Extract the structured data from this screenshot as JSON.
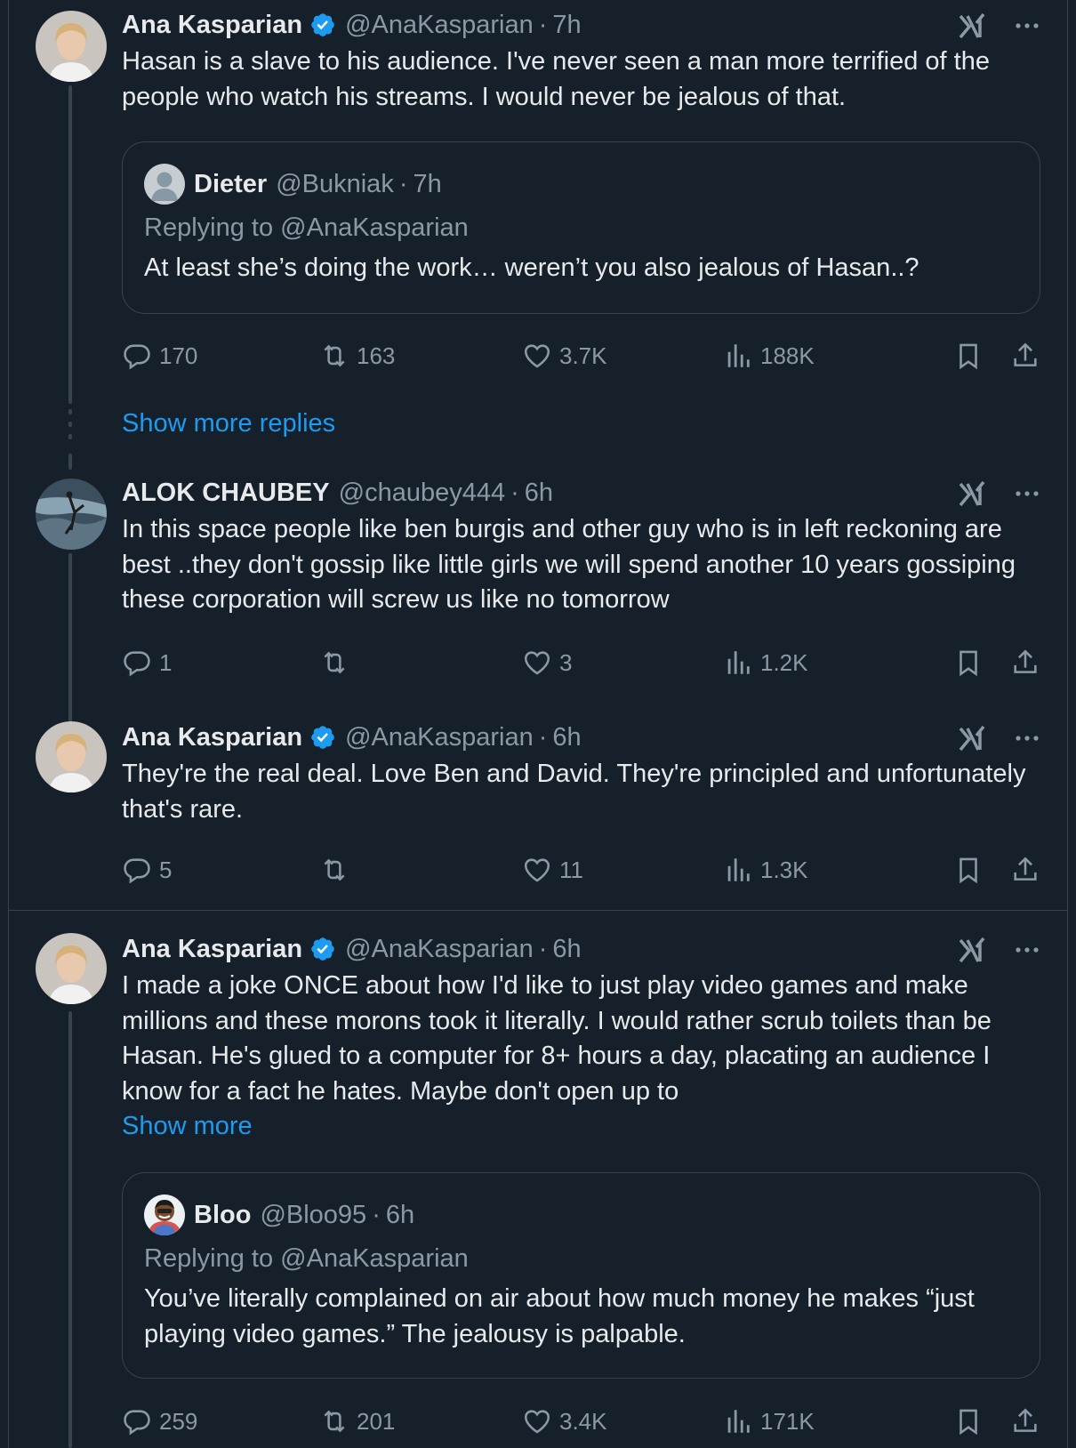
{
  "tweets": [
    {
      "name": "Ana Kasparian",
      "handle": "@AnaKasparian",
      "time": "7h",
      "verified": true,
      "text": "Hasan is a slave to his audience. I've never seen a man more terrified of the people who watch his streams. I would never be jealous of that.",
      "quote": {
        "name": "Dieter",
        "handle": "@Bukniak",
        "time": "7h",
        "replying_prefix": "Replying to ",
        "replying_handle": "@AnaKasparian",
        "text": "At least she’s doing the work… weren’t you also jealous of Hasan..?"
      },
      "stats": {
        "replies": "170",
        "retweets": "163",
        "likes": "3.7K",
        "views": "188K"
      }
    },
    {
      "show_more_replies": "Show more replies"
    },
    {
      "name": "ALOK CHAUBEY",
      "handle": "@chaubey444",
      "time": "6h",
      "verified": false,
      "text": "In this space people like ben burgis and other guy who is in left reckoning are best ..they don't gossip like little girls we will spend another 10 years gossiping these corporation will screw us like no tomorrow",
      "stats": {
        "replies": "1",
        "retweets": "",
        "likes": "3",
        "views": "1.2K"
      }
    },
    {
      "name": "Ana Kasparian",
      "handle": "@AnaKasparian",
      "time": "6h",
      "verified": true,
      "text": "They're the real deal. Love Ben and David. They're principled and unfortunately that's rare.",
      "stats": {
        "replies": "5",
        "retweets": "",
        "likes": "11",
        "views": "1.3K"
      }
    },
    {
      "name": "Ana Kasparian",
      "handle": "@AnaKasparian",
      "time": "6h",
      "verified": true,
      "text": "I made a joke ONCE about how I'd like to just play video games and make millions and these morons took it literally. I would rather scrub toilets than be Hasan. He's glued to a computer for 8+ hours a day, placating an audience I know for a fact he hates. Maybe don't open up to",
      "show_more": "Show more",
      "quote": {
        "name": "Bloo",
        "handle": "@Bloo95",
        "time": "6h",
        "replying_prefix": "Replying to ",
        "replying_handle": "@AnaKasparian",
        "text": "You’ve literally complained on air about how much money he makes “just playing video games.” The jealousy is palpable."
      },
      "stats": {
        "replies": "259",
        "retweets": "201",
        "likes": "3.4K",
        "views": "171K"
      }
    }
  ],
  "separator": "·",
  "icons": {
    "reply": "reply-icon",
    "retweet": "retweet-icon",
    "like": "heart-icon",
    "views": "views-icon",
    "bookmark": "bookmark-icon",
    "share": "share-icon",
    "grok": "grok-icon",
    "more": "more-icon",
    "verified": "verified-badge-icon"
  },
  "colors": {
    "background": "#15202b",
    "border": "#38444d",
    "text_primary": "#e7e9ea",
    "text_secondary": "#8b98a5",
    "link": "#1d9bf0",
    "verified": "#1d9bf0"
  }
}
